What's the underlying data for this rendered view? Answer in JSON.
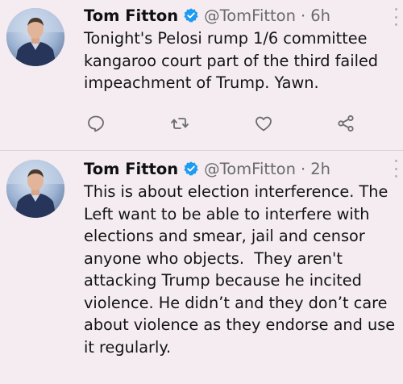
{
  "colors": {
    "background": "#f4ecf0",
    "text": "#141414",
    "muted": "#6a6a70",
    "verified": "#1d9bf0",
    "icon": "#6b6b72"
  },
  "tweets": [
    {
      "author_name": "Tom Fitton",
      "handle": "@TomFitton",
      "separator": "·",
      "time": "6h",
      "verified": true,
      "lines": [
        "Tonight's Pelosi rump 1/6 committee",
        "kangaroo court part of the third failed",
        "impeachment of Trump. Yawn."
      ],
      "actions": [
        "reply-icon",
        "retweet-icon",
        "like-icon",
        "share-icon"
      ]
    },
    {
      "author_name": "Tom Fitton",
      "handle": "@TomFitton",
      "separator": "·",
      "time": "2h",
      "verified": true,
      "lines": [
        "This is about election interference. The",
        "Left want to be able to interfere with",
        "elections and smear, jail and censor",
        "anyone who objects.  They aren't",
        "attacking Trump because he incited",
        "violence. He didn’t and they don’t care",
        "about violence as they endorse and use",
        "it regularly."
      ]
    }
  ]
}
